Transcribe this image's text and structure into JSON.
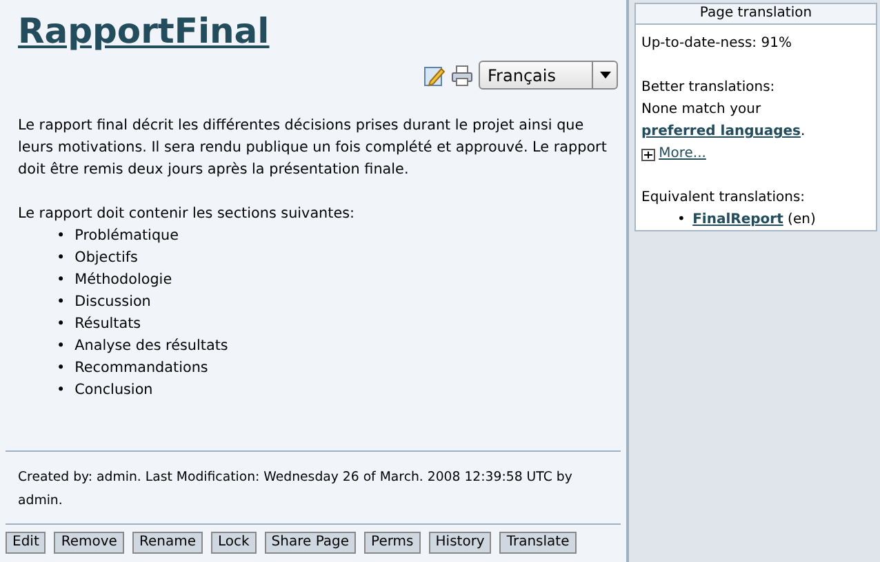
{
  "page": {
    "title": "RapportFinal",
    "language": "Français",
    "paragraphs": [
      "Le rapport final décrit les différentes décisions prises durant le projet ainsi que leurs motivations. Il sera rendu publique un fois complété et approuvé. Le rapport doit être remis deux jours après la présentation finale.",
      "Le rapport doit contenir les sections suivantes:"
    ],
    "marker": "•",
    "sections": [
      "Problématique",
      "Objectifs",
      "Méthodologie",
      "Discussion",
      "Résultats",
      "Analyse des résultats",
      "Recommandations",
      "Conclusion"
    ],
    "footer": "Created by: admin. Last Modification: Wednesday 26 of March. 2008 12:39:58 UTC by admin.",
    "buttons": [
      "Edit",
      "Remove",
      "Rename",
      "Lock",
      "Share Page",
      "Perms",
      "History",
      "Translate"
    ]
  },
  "sidebar": {
    "title": "Page translation",
    "up_to_date": "Up-to-date-ness: 91%",
    "better_label": "Better translations:",
    "none_text": "None match your",
    "preferred_link": "preferred languages",
    "after_link": ".",
    "more": "More...",
    "equivalent_label": "Equivalent translations:",
    "marker": "•",
    "equivalents": [
      {
        "link": "FinalReport",
        "lang": "(en)"
      }
    ]
  }
}
